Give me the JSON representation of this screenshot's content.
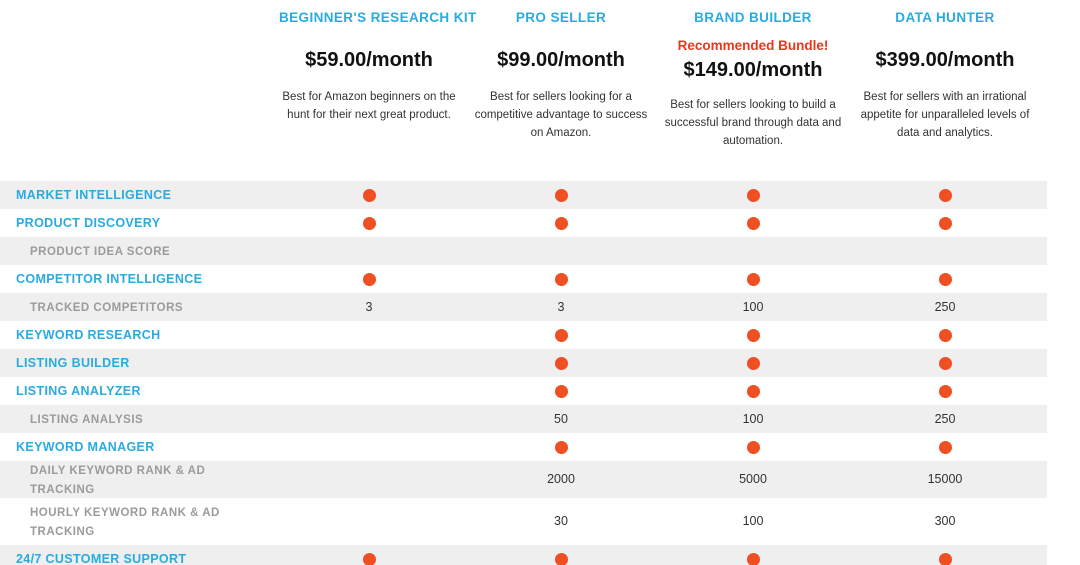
{
  "plans": [
    {
      "name": "BEGINNER'S RESEARCH KIT",
      "badge": "",
      "price": "$59.00/month",
      "description": "Best for Amazon beginners on the hunt for their next great product."
    },
    {
      "name": "PRO SELLER",
      "badge": "",
      "price": "$99.00/month",
      "description": "Best for sellers looking for a competitive advantage to success on Amazon."
    },
    {
      "name": "BRAND BUILDER",
      "badge": "Recommended Bundle!",
      "price": "$149.00/month",
      "description": "Best for sellers looking to build a successful brand through data and automation."
    },
    {
      "name": "DATA HUNTER",
      "badge": "",
      "price": "$399.00/month",
      "description": "Best for sellers with an irrational appetite for unparalleled levels of data and analytics."
    }
  ],
  "colors": {
    "accent_blue": "#29abe2",
    "accent_orange": "#f04e23",
    "badge_red": "#e8381e",
    "row_stripe": "#efefef",
    "sub_label_gray": "#9b9b9b"
  },
  "rows": [
    {
      "label": "MARKET INTELLIGENCE",
      "level": "main",
      "stripe": true,
      "tall": false,
      "cells": [
        "dot",
        "dot",
        "dot",
        "dot"
      ]
    },
    {
      "label": "PRODUCT DISCOVERY",
      "level": "main",
      "stripe": false,
      "tall": false,
      "cells": [
        "dot",
        "dot",
        "dot",
        "dot"
      ]
    },
    {
      "label": "PRODUCT IDEA SCORE",
      "level": "sub",
      "stripe": true,
      "tall": false,
      "cells": [
        "",
        "",
        "",
        ""
      ]
    },
    {
      "label": "COMPETITOR INTELLIGENCE",
      "level": "main",
      "stripe": false,
      "tall": false,
      "cells": [
        "dot",
        "dot",
        "dot",
        "dot"
      ]
    },
    {
      "label": "TRACKED COMPETITORS",
      "level": "sub",
      "stripe": true,
      "tall": false,
      "cells": [
        "3",
        "3",
        "100",
        "250"
      ]
    },
    {
      "label": "KEYWORD RESEARCH",
      "level": "main",
      "stripe": false,
      "tall": false,
      "cells": [
        "",
        "dot",
        "dot",
        "dot"
      ]
    },
    {
      "label": "LISTING BUILDER",
      "level": "main",
      "stripe": true,
      "tall": false,
      "cells": [
        "",
        "dot",
        "dot",
        "dot"
      ]
    },
    {
      "label": "LISTING ANALYZER",
      "level": "main",
      "stripe": false,
      "tall": false,
      "cells": [
        "",
        "dot",
        "dot",
        "dot"
      ]
    },
    {
      "label": "LISTING ANALYSIS",
      "level": "sub",
      "stripe": true,
      "tall": false,
      "cells": [
        "",
        "50",
        "100",
        "250"
      ]
    },
    {
      "label": "KEYWORD MANAGER",
      "level": "main",
      "stripe": false,
      "tall": false,
      "cells": [
        "",
        "dot",
        "dot",
        "dot"
      ]
    },
    {
      "label": "DAILY KEYWORD RANK & AD TRACKING",
      "level": "sub",
      "stripe": true,
      "tall": false,
      "cells": [
        "",
        "2000",
        "5000",
        "15000"
      ]
    },
    {
      "label": "HOURLY KEYWORD RANK & AD TRACKING",
      "level": "sub",
      "stripe": false,
      "tall": true,
      "cells": [
        "",
        "30",
        "100",
        "300"
      ]
    },
    {
      "label": "24/7 CUSTOMER SUPPORT",
      "level": "main",
      "stripe": true,
      "tall": false,
      "cells": [
        "dot",
        "dot",
        "dot",
        "dot"
      ]
    }
  ]
}
